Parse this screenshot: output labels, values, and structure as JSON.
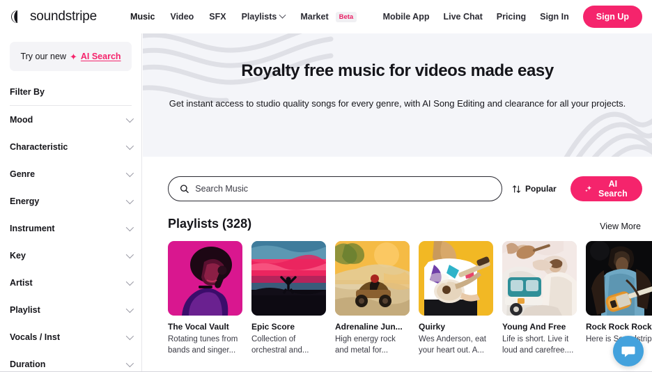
{
  "brand": {
    "name": "soundstripe",
    "logo_icon": "soundstripe-logo-icon"
  },
  "header": {
    "nav": [
      {
        "label": "Music",
        "active": true,
        "has_chevron": false
      },
      {
        "label": "Video",
        "active": false,
        "has_chevron": false
      },
      {
        "label": "SFX",
        "active": false,
        "has_chevron": false
      },
      {
        "label": "Playlists",
        "active": false,
        "has_chevron": true
      },
      {
        "label": "Market",
        "active": false,
        "has_chevron": false,
        "badge": "Beta"
      }
    ],
    "right_nav": [
      {
        "label": "Mobile App"
      },
      {
        "label": "Live Chat"
      },
      {
        "label": "Pricing"
      },
      {
        "label": "Sign In"
      }
    ],
    "signup_label": "Sign Up"
  },
  "sidebar": {
    "ai_banner": {
      "prefix": "Try our new",
      "link": "AI Search",
      "sparkle_icon": "sparkles-icon"
    },
    "filter_title": "Filter By",
    "filters": [
      {
        "label": "Mood"
      },
      {
        "label": "Characteristic"
      },
      {
        "label": "Genre"
      },
      {
        "label": "Energy"
      },
      {
        "label": "Instrument"
      },
      {
        "label": "Key"
      },
      {
        "label": "Artist"
      },
      {
        "label": "Playlist"
      },
      {
        "label": "Vocals / Inst"
      },
      {
        "label": "Duration"
      }
    ]
  },
  "hero": {
    "title": "Royalty free music for videos made easy",
    "subtitle": "Get instant access to studio quality songs for every genre, with AI Song Editing and clearance for all your projects."
  },
  "search": {
    "placeholder": "Search Music",
    "value": "",
    "icon": "search-icon",
    "sort_label": "Popular",
    "sort_icon": "sort-arrows-icon",
    "ai_search_label": "AI Search",
    "ai_search_icon": "sparkles-icon"
  },
  "playlists_section": {
    "title": "Playlists (328)",
    "view_more_label": "View More",
    "cards": [
      {
        "title": "The Vocal Vault",
        "desc": "Rotating tunes from bands and singer...",
        "thumb_name": "playlist-thumb-vocal-vault",
        "colors": [
          "#d9178f",
          "#7b1060",
          "#2a0a24"
        ]
      },
      {
        "title": "Epic Score",
        "desc": "Collection of orchestral and...",
        "thumb_name": "playlist-thumb-epic-score",
        "colors": [
          "#4e8aa8",
          "#f2376a",
          "#0d0a12"
        ]
      },
      {
        "title": "Adrenaline Jun...",
        "desc": "High energy rock and metal for...",
        "thumb_name": "playlist-thumb-adrenaline-junkie",
        "colors": [
          "#f0a82a",
          "#e2cfa6",
          "#8a6030"
        ]
      },
      {
        "title": "Quirky",
        "desc": "Wes Anderson, eat your heart out. A...",
        "thumb_name": "playlist-thumb-quirky",
        "colors": [
          "#f2b824",
          "#ffffff",
          "#6f3fa8"
        ]
      },
      {
        "title": "Young And Free",
        "desc": "Life is short. Live it loud and carefree....",
        "thumb_name": "playlist-thumb-young-and-free",
        "colors": [
          "#f3e9e6",
          "#2f8f98",
          "#d7b79a"
        ]
      },
      {
        "title": "Rock Rock Rock",
        "desc": "Here is Soundstrip...",
        "thumb_name": "playlist-thumb-rock-rock-rock",
        "colors": [
          "#0a0a0c",
          "#6fa8c4",
          "#e0922a"
        ]
      }
    ]
  },
  "chat_widget": {
    "icon": "chat-bubble-icon"
  },
  "colors": {
    "accent": "#f5246c",
    "hero_bg": "#f4f5f9",
    "text": "#15151a",
    "chat_blue": "#43a2dd"
  }
}
